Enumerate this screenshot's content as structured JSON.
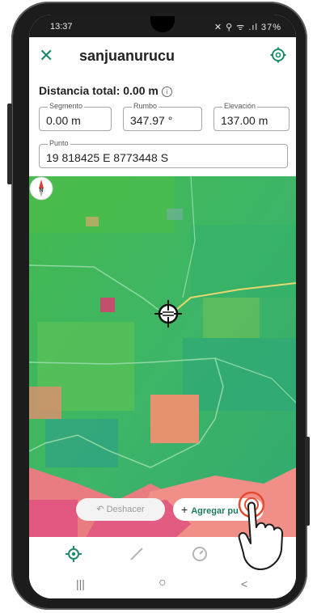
{
  "status_bar": {
    "time": "13:37",
    "battery": "37%",
    "icons_text": "✕ ⚲ ᯤ .ıl 37%"
  },
  "app_bar": {
    "title": "sanjuanurucu",
    "close_icon": "close-icon",
    "settings_icon": "gear-icon"
  },
  "measurements": {
    "total_label": "Distancia total: 0.00 m",
    "info_icon": "info-icon",
    "segment": {
      "label": "Segmento",
      "value": "0.00 m"
    },
    "heading": {
      "label": "Rumbo",
      "value": "347.97 °"
    },
    "elevation": {
      "label": "Elevación",
      "value": "137.00 m"
    },
    "point": {
      "label": "Punto",
      "value": "19 818425 E 8773448 S"
    }
  },
  "map": {
    "compass_letter": "N"
  },
  "actions": {
    "undo_label": "Deshacer",
    "add_label": "Agregar pu"
  },
  "bottom_nav": {
    "items": [
      "location-icon",
      "ruler-icon",
      "clock-icon",
      "more-icon"
    ]
  },
  "system_nav": {
    "recent": "|||",
    "home": "○",
    "back": "<"
  },
  "colors": {
    "accent": "#1e8a6b",
    "map_green": "#3bb64f",
    "map_pink": "#e0607a"
  }
}
